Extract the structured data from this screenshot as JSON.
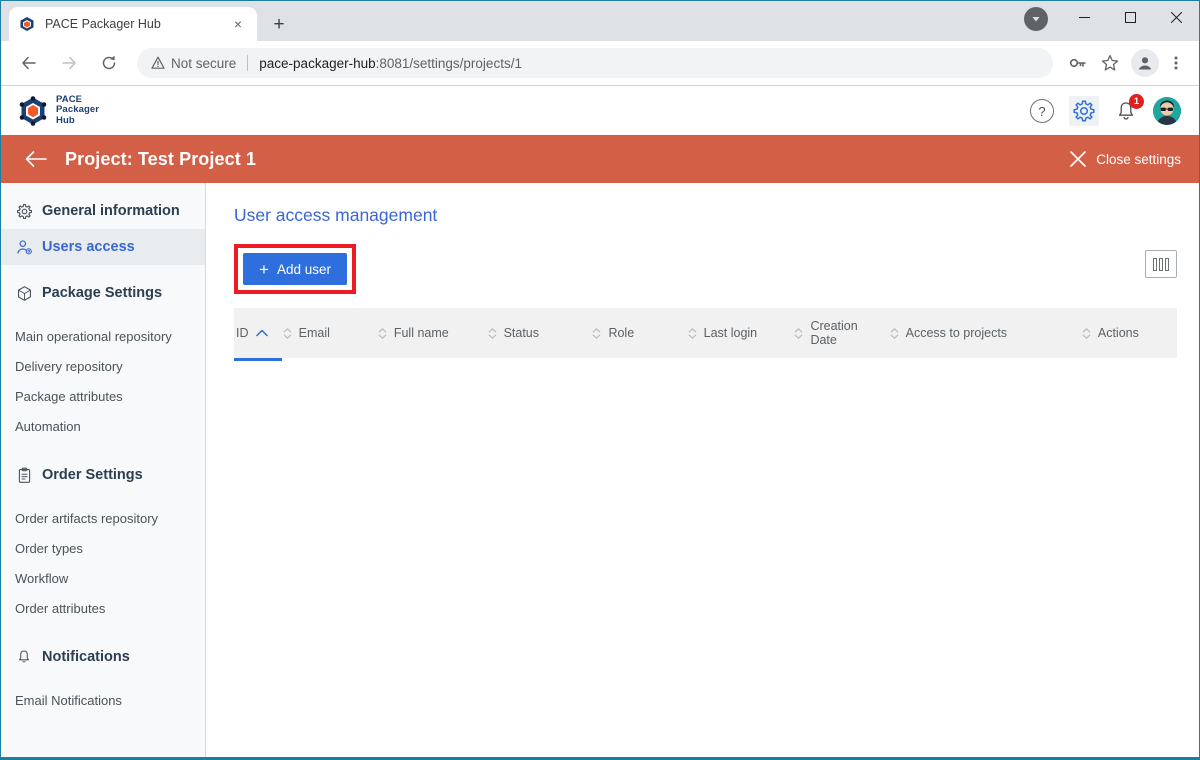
{
  "browser": {
    "tab": {
      "title": "PACE Packager Hub",
      "favicon": "cube-favicon",
      "close_label": "×"
    },
    "new_tab_label": "+",
    "window_controls": {
      "minimize": "—",
      "maximize": "□",
      "close": "✕"
    },
    "nav": {
      "back": "←",
      "forward": "→",
      "reload": "↻"
    },
    "omnibox": {
      "security_label": "Not secure",
      "url_host": "pace-packager-hub",
      "url_rest": ":8081/settings/projects/1"
    },
    "toolbar_icons": [
      "key-icon",
      "bookmark-star-icon",
      "profile-icon",
      "chrome-menu-icon"
    ]
  },
  "app_header": {
    "logo": {
      "line1": "PACE",
      "line2": "Packager",
      "line3": "Hub"
    },
    "icons": {
      "help": "?",
      "settings": "gear-icon",
      "notifications": "bell-icon",
      "notification_count": "1",
      "avatar": "user-avatar"
    }
  },
  "project_bar": {
    "back_label": "←",
    "title": "Project: Test Project 1",
    "close_settings_label": "Close settings",
    "close_icon": "✕",
    "color": "#d35f47"
  },
  "sidebar": {
    "items": [
      {
        "label": "General information",
        "icon": "gear-icon",
        "type": "group",
        "selected": false
      },
      {
        "label": "Users access",
        "icon": "user-access-icon",
        "type": "group",
        "selected": true
      },
      {
        "label": "Package Settings",
        "icon": "cube-icon",
        "type": "group",
        "selected": false
      },
      {
        "label": "Main operational repository",
        "type": "sub"
      },
      {
        "label": "Delivery repository",
        "type": "sub"
      },
      {
        "label": "Package attributes",
        "type": "sub"
      },
      {
        "label": "Automation",
        "type": "sub"
      },
      {
        "label": "Order Settings",
        "icon": "clipboard-icon",
        "type": "group",
        "selected": false
      },
      {
        "label": "Order artifacts repository",
        "type": "sub"
      },
      {
        "label": "Order types",
        "type": "sub"
      },
      {
        "label": "Workflow",
        "type": "sub"
      },
      {
        "label": "Order attributes",
        "type": "sub"
      },
      {
        "label": "Notifications",
        "icon": "bell-icon",
        "type": "group",
        "selected": false
      },
      {
        "label": "Email Notifications",
        "type": "sub"
      }
    ]
  },
  "main": {
    "title": "User access management",
    "add_user_button": {
      "label": "Add user",
      "plus": "+",
      "color": "#2f6fdd",
      "highlighted": true
    },
    "highlight_color": "#ee1b24",
    "column_settings_icon": "columns-icon",
    "table": {
      "columns": [
        {
          "label": "ID",
          "sort": "asc",
          "active": true
        },
        {
          "label": "Email",
          "sort": "none",
          "active": false
        },
        {
          "label": "Full name",
          "sort": "none",
          "active": false
        },
        {
          "label": "Status",
          "sort": "none",
          "active": false
        },
        {
          "label": "Role",
          "sort": "none",
          "active": false
        },
        {
          "label": "Last login",
          "sort": "none",
          "active": false
        },
        {
          "label": "Creation\nDate",
          "sort": "none",
          "active": false
        },
        {
          "label": "Access to projects",
          "sort": "none",
          "active": false
        },
        {
          "label": "Actions",
          "sort": "none",
          "active": false
        }
      ],
      "rows": []
    }
  }
}
